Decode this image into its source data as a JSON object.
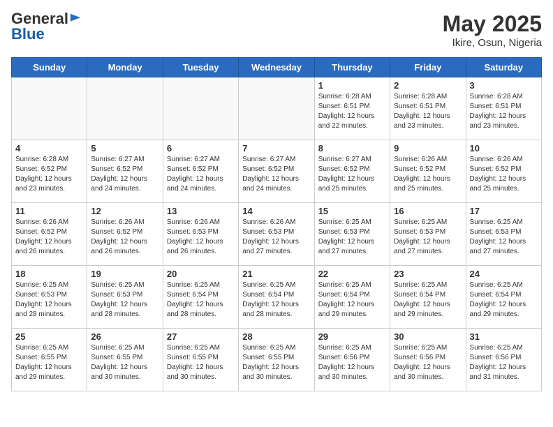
{
  "header": {
    "logo_general": "General",
    "logo_blue": "Blue",
    "month_title": "May 2025",
    "location": "Ikire, Osun, Nigeria"
  },
  "days_of_week": [
    "Sunday",
    "Monday",
    "Tuesday",
    "Wednesday",
    "Thursday",
    "Friday",
    "Saturday"
  ],
  "weeks": [
    [
      {
        "day": "",
        "info": ""
      },
      {
        "day": "",
        "info": ""
      },
      {
        "day": "",
        "info": ""
      },
      {
        "day": "",
        "info": ""
      },
      {
        "day": "1",
        "info": "Sunrise: 6:28 AM\nSunset: 6:51 PM\nDaylight: 12 hours\nand 22 minutes."
      },
      {
        "day": "2",
        "info": "Sunrise: 6:28 AM\nSunset: 6:51 PM\nDaylight: 12 hours\nand 23 minutes."
      },
      {
        "day": "3",
        "info": "Sunrise: 6:28 AM\nSunset: 6:51 PM\nDaylight: 12 hours\nand 23 minutes."
      }
    ],
    [
      {
        "day": "4",
        "info": "Sunrise: 6:28 AM\nSunset: 6:52 PM\nDaylight: 12 hours\nand 23 minutes."
      },
      {
        "day": "5",
        "info": "Sunrise: 6:27 AM\nSunset: 6:52 PM\nDaylight: 12 hours\nand 24 minutes."
      },
      {
        "day": "6",
        "info": "Sunrise: 6:27 AM\nSunset: 6:52 PM\nDaylight: 12 hours\nand 24 minutes."
      },
      {
        "day": "7",
        "info": "Sunrise: 6:27 AM\nSunset: 6:52 PM\nDaylight: 12 hours\nand 24 minutes."
      },
      {
        "day": "8",
        "info": "Sunrise: 6:27 AM\nSunset: 6:52 PM\nDaylight: 12 hours\nand 25 minutes."
      },
      {
        "day": "9",
        "info": "Sunrise: 6:26 AM\nSunset: 6:52 PM\nDaylight: 12 hours\nand 25 minutes."
      },
      {
        "day": "10",
        "info": "Sunrise: 6:26 AM\nSunset: 6:52 PM\nDaylight: 12 hours\nand 25 minutes."
      }
    ],
    [
      {
        "day": "11",
        "info": "Sunrise: 6:26 AM\nSunset: 6:52 PM\nDaylight: 12 hours\nand 26 minutes."
      },
      {
        "day": "12",
        "info": "Sunrise: 6:26 AM\nSunset: 6:52 PM\nDaylight: 12 hours\nand 26 minutes."
      },
      {
        "day": "13",
        "info": "Sunrise: 6:26 AM\nSunset: 6:53 PM\nDaylight: 12 hours\nand 26 minutes."
      },
      {
        "day": "14",
        "info": "Sunrise: 6:26 AM\nSunset: 6:53 PM\nDaylight: 12 hours\nand 27 minutes."
      },
      {
        "day": "15",
        "info": "Sunrise: 6:25 AM\nSunset: 6:53 PM\nDaylight: 12 hours\nand 27 minutes."
      },
      {
        "day": "16",
        "info": "Sunrise: 6:25 AM\nSunset: 6:53 PM\nDaylight: 12 hours\nand 27 minutes."
      },
      {
        "day": "17",
        "info": "Sunrise: 6:25 AM\nSunset: 6:53 PM\nDaylight: 12 hours\nand 27 minutes."
      }
    ],
    [
      {
        "day": "18",
        "info": "Sunrise: 6:25 AM\nSunset: 6:53 PM\nDaylight: 12 hours\nand 28 minutes."
      },
      {
        "day": "19",
        "info": "Sunrise: 6:25 AM\nSunset: 6:53 PM\nDaylight: 12 hours\nand 28 minutes."
      },
      {
        "day": "20",
        "info": "Sunrise: 6:25 AM\nSunset: 6:54 PM\nDaylight: 12 hours\nand 28 minutes."
      },
      {
        "day": "21",
        "info": "Sunrise: 6:25 AM\nSunset: 6:54 PM\nDaylight: 12 hours\nand 28 minutes."
      },
      {
        "day": "22",
        "info": "Sunrise: 6:25 AM\nSunset: 6:54 PM\nDaylight: 12 hours\nand 29 minutes."
      },
      {
        "day": "23",
        "info": "Sunrise: 6:25 AM\nSunset: 6:54 PM\nDaylight: 12 hours\nand 29 minutes."
      },
      {
        "day": "24",
        "info": "Sunrise: 6:25 AM\nSunset: 6:54 PM\nDaylight: 12 hours\nand 29 minutes."
      }
    ],
    [
      {
        "day": "25",
        "info": "Sunrise: 6:25 AM\nSunset: 6:55 PM\nDaylight: 12 hours\nand 29 minutes."
      },
      {
        "day": "26",
        "info": "Sunrise: 6:25 AM\nSunset: 6:55 PM\nDaylight: 12 hours\nand 30 minutes."
      },
      {
        "day": "27",
        "info": "Sunrise: 6:25 AM\nSunset: 6:55 PM\nDaylight: 12 hours\nand 30 minutes."
      },
      {
        "day": "28",
        "info": "Sunrise: 6:25 AM\nSunset: 6:55 PM\nDaylight: 12 hours\nand 30 minutes."
      },
      {
        "day": "29",
        "info": "Sunrise: 6:25 AM\nSunset: 6:56 PM\nDaylight: 12 hours\nand 30 minutes."
      },
      {
        "day": "30",
        "info": "Sunrise: 6:25 AM\nSunset: 6:56 PM\nDaylight: 12 hours\nand 30 minutes."
      },
      {
        "day": "31",
        "info": "Sunrise: 6:25 AM\nSunset: 6:56 PM\nDaylight: 12 hours\nand 31 minutes."
      }
    ]
  ]
}
